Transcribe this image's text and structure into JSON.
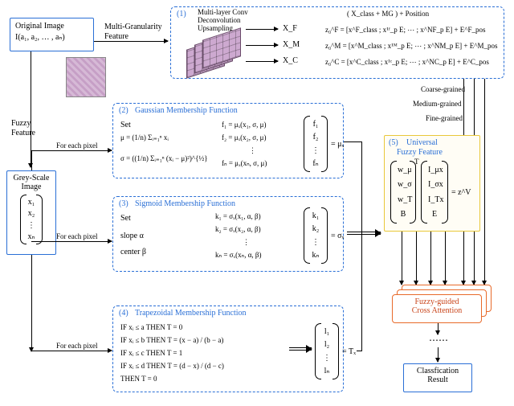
{
  "original_image": {
    "title1": "Original Image",
    "equation": "I(a₁, a₂, … , aₙ)"
  },
  "mg_feature_label1": "Multi-Granularity",
  "mg_feature_label2": "Feature",
  "fuzzy_feature_label1": "Fuzzy",
  "fuzzy_feature_label2": "Feature",
  "greyscale": {
    "title1": "Grey-Scale",
    "title2": "Image",
    "items": [
      "x₁",
      "x₂",
      "⋮",
      "xₙ"
    ]
  },
  "for_each": "For each pixel",
  "sec1": {
    "num": "(1)",
    "t1": "Multi-layer Conv",
    "t2": "Deconvolution",
    "t3": "Upsampling",
    "out1": "X_F",
    "out2": "X_M",
    "out3": "X_C",
    "rhs_title": "( X_class + MG ) + Position",
    "z0F": "z₀^F = [x^F_class ; x¹ᶠ_p E; ⋯ ; x^NF_p E] + E^F_pos",
    "z0M": "z₀^M = [x^M_class ; x¹ᴹ_p E; ⋯ ; x^NM_p E] + E^M_pos",
    "z0C": "z₀^C = [x^C_class ; x¹ᶜ_p E; ⋯ ; x^NC_p E] + E^C_pos"
  },
  "grains": {
    "coarse": "Coarse-grained",
    "medium": "Medium-grained",
    "fine": "Fine-grained"
  },
  "sec2": {
    "num": "(2)",
    "title": "Gaussian Membership Function",
    "set": "Set",
    "mu": "μ = (1/n) Σᵢ₌₁ⁿ xᵢ",
    "sigma": "σ = ((1/n) Σᵢ₌₁ⁿ (xᵢ − μ)²)^{½}",
    "f1": "f₁ = μₓ(x₁, σ, μ)",
    "f2": "f₂ = μₓ(x₂, σ, μ)",
    "fdots": "⋮",
    "fn": "fₙ = μₓ(xₙ, σ, μ)",
    "vec": [
      "f₁",
      "f₂",
      "⋮",
      "fₙ"
    ],
    "eq": "= μₓ"
  },
  "sec3": {
    "num": "(3)",
    "title": "Sigmoid Membership Function",
    "set": "Set",
    "slope": "slope   α",
    "center": "center  β",
    "k1": "k₁ = σₓ(x₁, α, β)",
    "k2": "k₂ = σₓ(x₂, α, β)",
    "kdots": "⋮",
    "kn": "kₙ = σₓ(xₙ, α, β)",
    "vec": [
      "k₁",
      "k₂",
      "⋮",
      "kₙ"
    ],
    "eq": "= σₓ"
  },
  "sec4": {
    "num": "(4)",
    "title": "Trapezoidal Membership Function",
    "l1": "IF   xᵢ ≤ a   THEN   T = 0",
    "l2": "IF   xᵢ ≤ b   THEN   T = (x − a) / (b − a)",
    "l3": "IF   xᵢ ≤ c   THEN   T = 1",
    "l4": "IF   xᵢ ≤ d   THEN   T = (d − x) / (d − c)",
    "l5": "THEN   T = 0",
    "vec": [
      "l₁",
      "l₂",
      "⋮",
      "lₙ"
    ],
    "eq": "= Tₓ"
  },
  "sec5": {
    "num": "(5)",
    "t1": "Universal",
    "t2": "Fuzzy Feature",
    "left": [
      "w_μ",
      "w_σ",
      "w_T",
      "B"
    ],
    "right": [
      "I_μx",
      "I_σx",
      "I_Tx",
      "E"
    ],
    "eq": "= z^V",
    "Tsup": "T"
  },
  "fuzzy_cross": {
    "l1": "Fuzzy-guided",
    "l2": "Cross Attention"
  },
  "dots": "⋯⋯",
  "result": {
    "l1": "Classfication",
    "l2": "Result"
  },
  "chart_data": null
}
